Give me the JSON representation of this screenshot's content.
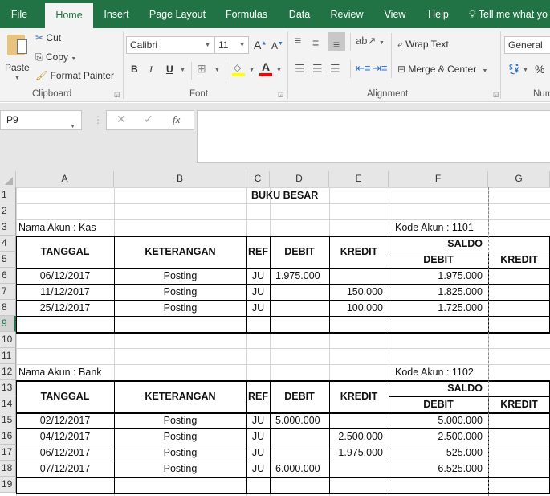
{
  "ribbon_tabs": [
    "File",
    "Home",
    "Insert",
    "Page Layout",
    "Formulas",
    "Data",
    "Review",
    "View",
    "Help"
  ],
  "active_tab": "Home",
  "tell_me": "Tell me what yo",
  "clipboard": {
    "paste": "Paste",
    "cut": "Cut",
    "copy": "Copy",
    "format_painter": "Format Painter",
    "label": "Clipboard"
  },
  "font": {
    "name": "Calibri",
    "size": "11",
    "bold": "B",
    "italic": "I",
    "underline": "U",
    "label": "Font",
    "highlight_color": "#ffff00",
    "font_color": "#ff0000"
  },
  "alignment": {
    "wrap_text": "Wrap Text",
    "merge_center": "Merge & Center",
    "label": "Alignment"
  },
  "number": {
    "format": "General",
    "percent": "%",
    "label": "Num"
  },
  "formula_bar": {
    "name_box": "P9",
    "cancel": "✕",
    "enter": "✓",
    "fx": "fx",
    "value": ""
  },
  "columns": [
    "A",
    "B",
    "C",
    "D",
    "E",
    "F",
    "G"
  ],
  "rows": [
    "1",
    "2",
    "3",
    "4",
    "5",
    "6",
    "7",
    "8",
    "9",
    "10",
    "11",
    "12",
    "13",
    "14",
    "15",
    "16",
    "17",
    "18",
    "19"
  ],
  "selected_row": "9",
  "sheet": {
    "title": "BUKU BESAR",
    "headers": {
      "tanggal": "TANGGAL",
      "keterangan": "KETERANGAN",
      "ref": "REF",
      "debit": "DEBIT",
      "kredit": "KREDIT",
      "saldo": "SALDO",
      "saldo_debit": "DEBIT",
      "saldo_kredit": "KREDIT"
    },
    "ledgers": [
      {
        "account_name": "Nama Akun : Kas",
        "account_code": "Kode Akun : 1101",
        "entries": [
          {
            "tanggal": "06/12/2017",
            "keterangan": "Posting",
            "ref": "JU",
            "debit": "1.975.000",
            "kredit": "",
            "saldo_debit": "1.975.000",
            "saldo_kredit": ""
          },
          {
            "tanggal": "11/12/2017",
            "keterangan": "Posting",
            "ref": "JU",
            "debit": "",
            "kredit": "150.000",
            "saldo_debit": "1.825.000",
            "saldo_kredit": ""
          },
          {
            "tanggal": "25/12/2017",
            "keterangan": "Posting",
            "ref": "JU",
            "debit": "",
            "kredit": "100.000",
            "saldo_debit": "1.725.000",
            "saldo_kredit": ""
          }
        ]
      },
      {
        "account_name": "Nama Akun : Bank",
        "account_code": "Kode Akun : 1102",
        "entries": [
          {
            "tanggal": "02/12/2017",
            "keterangan": "Posting",
            "ref": "JU",
            "debit": "5.000.000",
            "kredit": "",
            "saldo_debit": "5.000.000",
            "saldo_kredit": ""
          },
          {
            "tanggal": "04/12/2017",
            "keterangan": "Posting",
            "ref": "JU",
            "debit": "",
            "kredit": "2.500.000",
            "saldo_debit": "2.500.000",
            "saldo_kredit": ""
          },
          {
            "tanggal": "06/12/2017",
            "keterangan": "Posting",
            "ref": "JU",
            "debit": "",
            "kredit": "1.975.000",
            "saldo_debit": "525.000",
            "saldo_kredit": ""
          },
          {
            "tanggal": "07/12/2017",
            "keterangan": "Posting",
            "ref": "JU",
            "debit": "6.000.000",
            "kredit": "",
            "saldo_debit": "6.525.000",
            "saldo_kredit": ""
          }
        ]
      }
    ]
  }
}
